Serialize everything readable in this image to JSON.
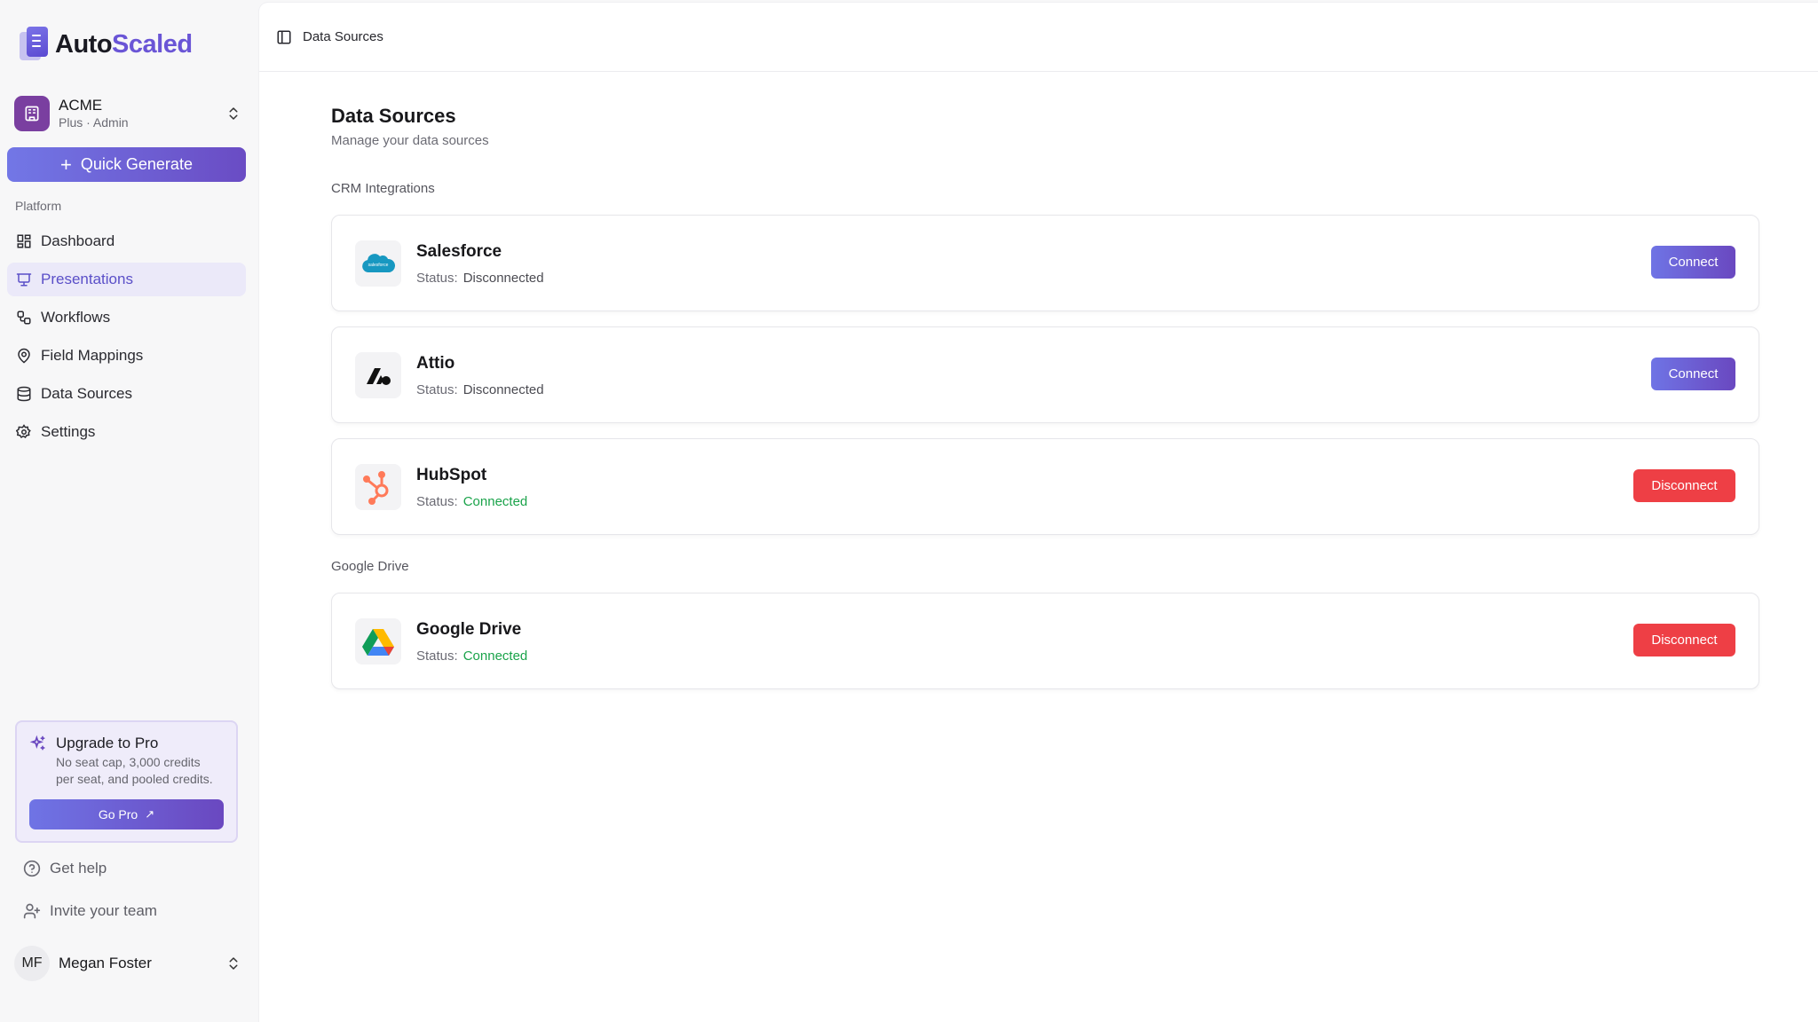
{
  "app": {
    "logo_part1": "Auto",
    "logo_part2": "Scaled"
  },
  "org": {
    "name": "ACME",
    "plan": "Plus · Admin"
  },
  "sidebar": {
    "quick_generate": "Quick Generate",
    "section_label": "Platform",
    "items": [
      {
        "label": "Dashboard",
        "icon": "dashboard-icon"
      },
      {
        "label": "Presentations",
        "icon": "presentation-icon",
        "active": true
      },
      {
        "label": "Workflows",
        "icon": "workflow-icon"
      },
      {
        "label": "Field Mappings",
        "icon": "map-pin-icon"
      },
      {
        "label": "Data Sources",
        "icon": "database-icon"
      },
      {
        "label": "Settings",
        "icon": "gear-icon"
      }
    ]
  },
  "upgrade": {
    "title": "Upgrade to Pro",
    "desc_line1": "No seat cap, 3,000 credits",
    "desc_line2": "per seat, and pooled credits.",
    "button": "Go Pro",
    "button_arrow": "↗"
  },
  "footer": {
    "help": "Get help",
    "invite": "Invite your team",
    "user_initials": "MF",
    "user_name": "Megan Foster"
  },
  "header": {
    "breadcrumb": "Data Sources"
  },
  "page": {
    "title": "Data Sources",
    "subtitle": "Manage your data sources",
    "status_label": "Status:",
    "groups": [
      {
        "label": "CRM Integrations",
        "sources": [
          {
            "name": "Salesforce",
            "status": "Disconnected",
            "action": "Connect",
            "logo": "salesforce-logo"
          },
          {
            "name": "Attio",
            "status": "Disconnected",
            "action": "Connect",
            "logo": "attio-logo"
          },
          {
            "name": "HubSpot",
            "status": "Connected",
            "action": "Disconnect",
            "logo": "hubspot-logo"
          }
        ]
      },
      {
        "label": "Google Drive",
        "sources": [
          {
            "name": "Google Drive",
            "status": "Connected",
            "action": "Disconnect",
            "logo": "google-drive-logo"
          }
        ]
      }
    ]
  },
  "colors": {
    "accent": "#6a55d6",
    "connected": "#1aa34a",
    "disconnect_button": "#ee3f45",
    "salesforce": "#1798c1",
    "hubspot": "#ff7a59"
  }
}
